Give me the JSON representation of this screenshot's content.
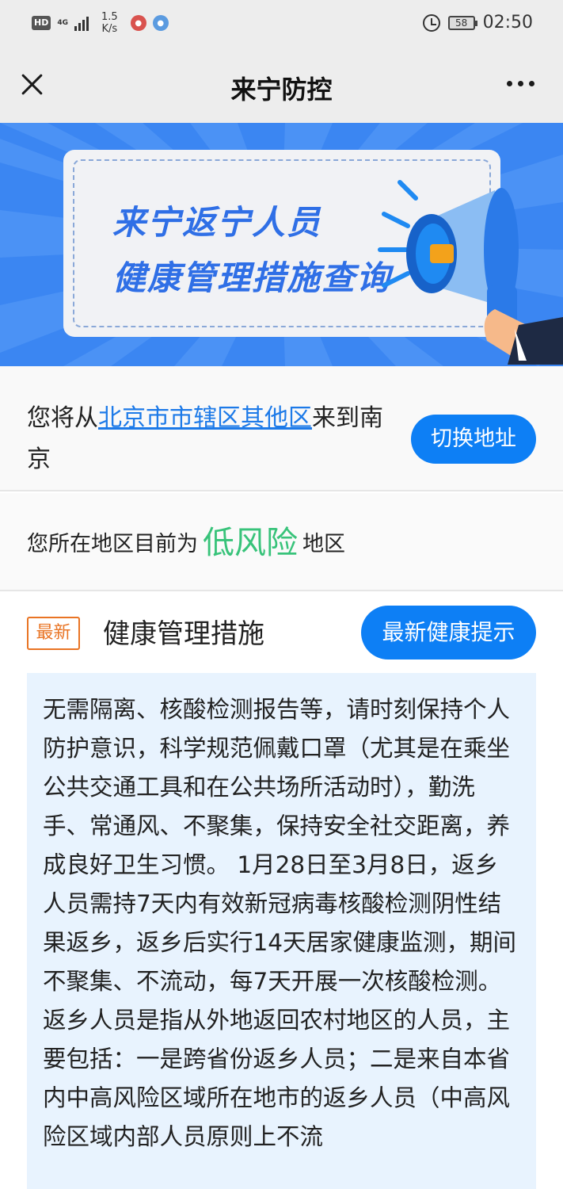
{
  "status_bar": {
    "hd": "HD",
    "network": "4G",
    "speed_value": "1.5",
    "speed_unit": "K/s",
    "battery": "58",
    "time": "02:50"
  },
  "header": {
    "title": "来宁防控"
  },
  "banner": {
    "line1": "来宁返宁人员",
    "line2": "健康管理措施查询"
  },
  "origin": {
    "prefix": "您将从",
    "location": "北京市市辖区其他区",
    "suffix": "来到南京",
    "switch_label": "切换地址"
  },
  "risk": {
    "prefix": "您所在地区目前为",
    "level": "低风险",
    "suffix": "地区"
  },
  "measures": {
    "badge": "最新",
    "title": "健康管理措施",
    "tips_label": "最新健康提示",
    "body": "无需隔离、核酸检测报告等，请时刻保持个人防护意识，科学规范佩戴口罩（尤其是在乘坐公共交通工具和在公共场所活动时），勤洗手、常通风、不聚集，保持安全社交距离，养成良好卫生习惯。 1月28日至3月8日，返乡人员需持7天内有效新冠病毒核酸检测阴性结果返乡，返乡后实行14天居家健康监测，期间不聚集、不流动，每7天开展一次核酸检测。 返乡人员是指从外地返回农村地区的人员，主要包括：一是跨省份返乡人员；二是来自本省内中高风险区域所在地市的返乡人员（中高风险区域内部人员原则上不流"
  },
  "colors": {
    "accent": "#0d7ff5",
    "risk_low": "#38c37a",
    "badge": "#e97424",
    "banner_bg": "#3b86f2"
  }
}
